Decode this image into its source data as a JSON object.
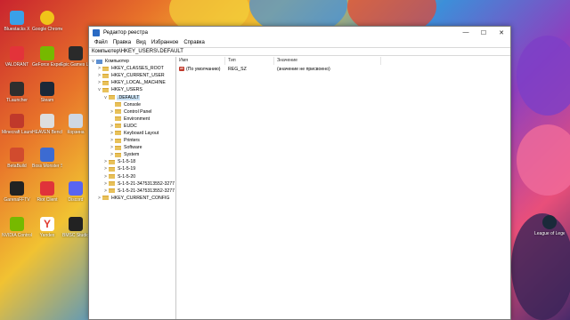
{
  "desktop": {
    "icons_left_col": [
      "Bluestacks X",
      "VALORANT",
      "TLauncher",
      "Minecraft Launcher",
      "BetaBuild",
      "GarenaFFTV",
      "NVIDIA Control Panel"
    ],
    "icons_mid_col": [
      "Google Chrome",
      "GeForce Experience",
      "Steam",
      "HEAVEN Benchmark",
      "Boss Monster Star",
      "Riot Client",
      "Yandex"
    ],
    "icons_third_col": [
      "",
      "Epic Games Launcher",
      "",
      "Корзина",
      "",
      "Discord",
      "BMSC Studio"
    ],
    "right_icon": "League of Legends"
  },
  "window": {
    "title": "Редактор реестра",
    "controls": {
      "minimize": "—",
      "maximize": "☐",
      "close": "✕"
    },
    "menu": [
      "Файл",
      "Правка",
      "Вид",
      "Избранное",
      "Справка"
    ],
    "address": "Компьютер\\HKEY_USERS\\.DEFAULT",
    "tree": [
      {
        "label": "Компьютер",
        "level": 0,
        "expanded": "v",
        "icon": "computer-icon"
      },
      {
        "label": "HKEY_CLASSES_ROOT",
        "level": 1,
        "expanded": ">"
      },
      {
        "label": "HKEY_CURRENT_USER",
        "level": 1,
        "expanded": ">"
      },
      {
        "label": "HKEY_LOCAL_MACHINE",
        "level": 1,
        "expanded": ">"
      },
      {
        "label": "HKEY_USERS",
        "level": 1,
        "expanded": "v"
      },
      {
        "label": ".DEFAULT",
        "level": 2,
        "expanded": "v",
        "selected": true
      },
      {
        "label": "Console",
        "level": 3,
        "expanded": ""
      },
      {
        "label": "Control Panel",
        "level": 3,
        "expanded": ">"
      },
      {
        "label": "Environment",
        "level": 3,
        "expanded": ""
      },
      {
        "label": "EUDC",
        "level": 3,
        "expanded": ">"
      },
      {
        "label": "Keyboard Layout",
        "level": 3,
        "expanded": ">"
      },
      {
        "label": "Printers",
        "level": 3,
        "expanded": ">"
      },
      {
        "label": "Software",
        "level": 3,
        "expanded": ">"
      },
      {
        "label": "System",
        "level": 3,
        "expanded": ">"
      },
      {
        "label": "S-1-5-18",
        "level": 2,
        "expanded": ">"
      },
      {
        "label": "S-1-5-19",
        "level": 2,
        "expanded": ">"
      },
      {
        "label": "S-1-5-20",
        "level": 2,
        "expanded": ">"
      },
      {
        "label": "S-1-5-21-3475313552-3277",
        "level": 2,
        "expanded": ">"
      },
      {
        "label": "S-1-5-21-3475313552-3277",
        "level": 2,
        "expanded": ">"
      },
      {
        "label": "HKEY_CURRENT_CONFIG",
        "level": 1,
        "expanded": ">"
      }
    ],
    "columns": {
      "name": "Имя",
      "type": "Тип",
      "value": "Значение"
    },
    "rows": [
      {
        "icon": "ab",
        "name": "(По умолчанию)",
        "type": "REG_SZ",
        "value": "(значение не присвоено)"
      }
    ]
  }
}
